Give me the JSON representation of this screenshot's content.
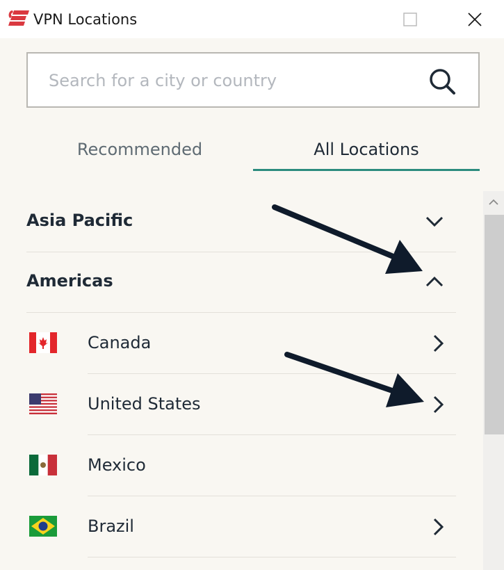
{
  "window": {
    "title": "VPN Locations",
    "controls": [
      "minimize-icon",
      "maximize-icon",
      "close-icon"
    ]
  },
  "search": {
    "placeholder": "Search for a city or country",
    "value": "",
    "icon": "search-icon"
  },
  "tabs": [
    {
      "label": "Recommended",
      "active": false
    },
    {
      "label": "All Locations",
      "active": true
    }
  ],
  "regions": [
    {
      "label": "Asia Pacific",
      "expanded": false,
      "icon": "chevron-down-icon"
    },
    {
      "label": "Americas",
      "expanded": true,
      "icon": "chevron-up-icon"
    }
  ],
  "countries": [
    {
      "label": "Canada",
      "flag": "canada-flag-icon",
      "has_submenu": true
    },
    {
      "label": "United States",
      "flag": "us-flag-icon",
      "has_submenu": true
    },
    {
      "label": "Mexico",
      "flag": "mexico-flag-icon",
      "has_submenu": false
    },
    {
      "label": "Brazil",
      "flag": "brazil-flag-icon",
      "has_submenu": true
    }
  ],
  "colors": {
    "accent": "#2c8c7e",
    "brand": "#da3940",
    "background": "#f9f7f2",
    "text": "#1f2a36",
    "arrow": "#0f1b2b"
  }
}
